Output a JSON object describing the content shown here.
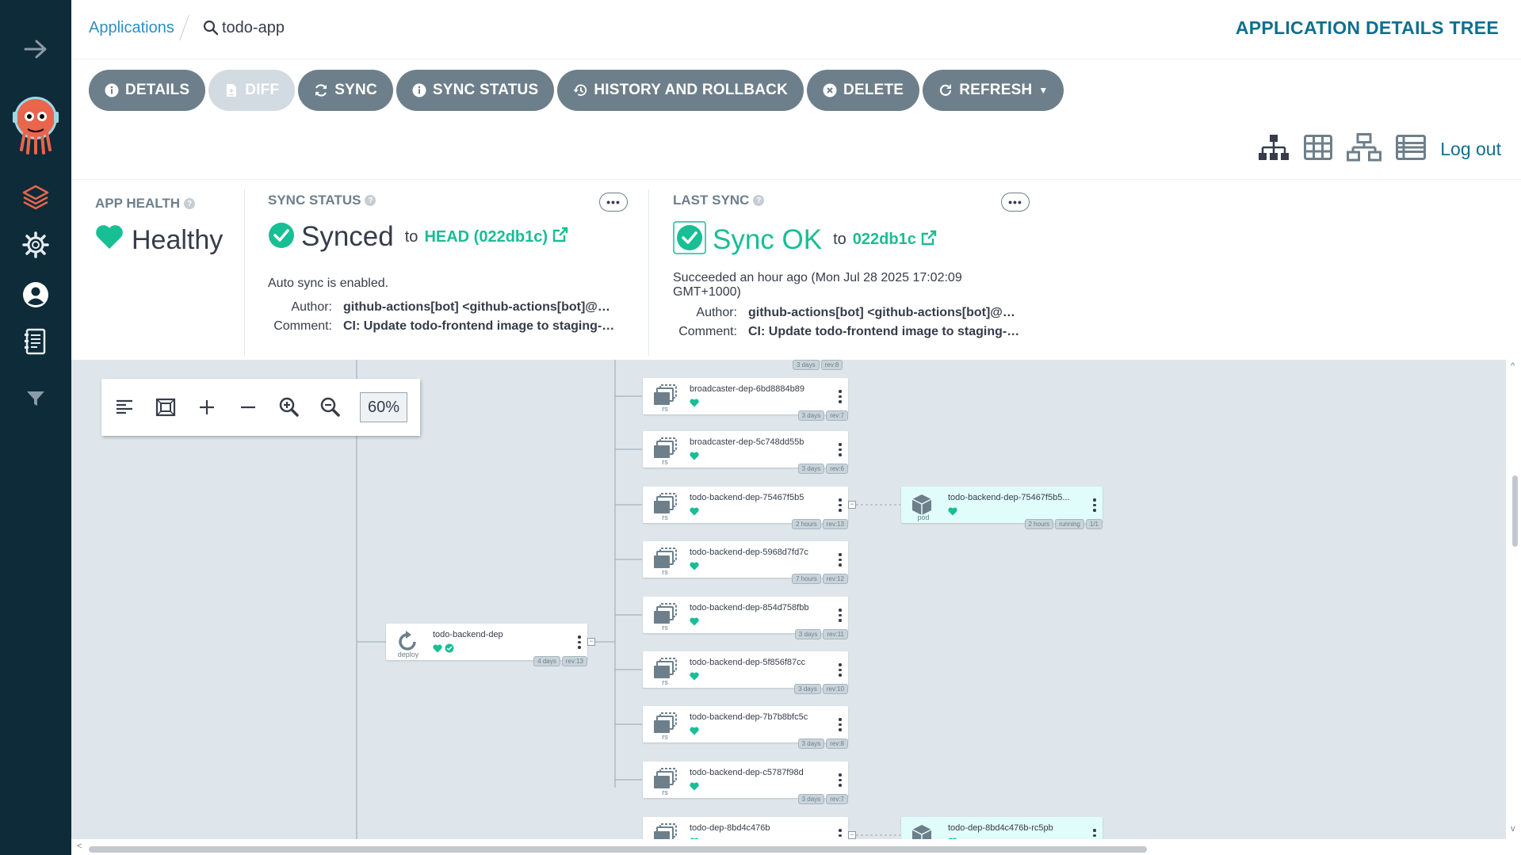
{
  "breadcrumb": {
    "link": "Applications",
    "current": "todo-app"
  },
  "page_title": "APPLICATION DETAILS TREE",
  "toolbar": {
    "details": "DETAILS",
    "diff": "DIFF",
    "sync": "SYNC",
    "sync_status": "SYNC STATUS",
    "history": "HISTORY AND ROLLBACK",
    "delete": "DELETE",
    "refresh": "REFRESH"
  },
  "logout": "Log out",
  "app_health": {
    "label": "APP HEALTH",
    "value": "Healthy"
  },
  "sync_status": {
    "label": "SYNC STATUS",
    "value": "Synced",
    "to": "to",
    "revision": "HEAD (022db1c)",
    "auto_sync": "Auto sync is enabled.",
    "author_label": "Author:",
    "author": "github-actions[bot] <github-actions[bot]@us...",
    "comment_label": "Comment:",
    "comment": "CI: Update todo-frontend image to staging-0..."
  },
  "last_sync": {
    "label": "LAST SYNC",
    "value": "Sync OK",
    "to": "to",
    "revision": "022db1c",
    "succeeded_line1": "Succeeded an hour ago (Mon Jul 28 2025 17:02:09",
    "succeeded_line2": "GMT+1000)",
    "author_label": "Author:",
    "author": "github-actions[bot] <github-actions[bot]@us...",
    "comment_label": "Comment:",
    "comment": "CI: Update todo-frontend image to staging-0..."
  },
  "zoom": {
    "value": "60%"
  },
  "graph": {
    "top_partial_tags": [
      "3 days",
      "rev:8"
    ],
    "deploy": {
      "name": "todo-backend-dep",
      "kind": "deploy",
      "tags": [
        "4 days",
        "rev:13"
      ]
    },
    "replicasets": [
      {
        "name": "broadcaster-dep-6bd8884b89",
        "kind": "rs",
        "tags": [
          "3 days",
          "rev:7"
        ]
      },
      {
        "name": "broadcaster-dep-5c748dd55b",
        "kind": "rs",
        "tags": [
          "3 days",
          "rev:6"
        ]
      },
      {
        "name": "todo-backend-dep-75467f5b5",
        "kind": "rs",
        "tags": [
          "2 hours",
          "rev:13"
        ]
      },
      {
        "name": "todo-backend-dep-5968d7fd7c",
        "kind": "rs",
        "tags": [
          "7 hours",
          "rev:12"
        ]
      },
      {
        "name": "todo-backend-dep-854d758fbb",
        "kind": "rs",
        "tags": [
          "3 days",
          "rev:11"
        ]
      },
      {
        "name": "todo-backend-dep-5f856f87cc",
        "kind": "rs",
        "tags": [
          "3 days",
          "rev:10"
        ]
      },
      {
        "name": "todo-backend-dep-7b7b8bfc5c",
        "kind": "rs",
        "tags": [
          "3 days",
          "rev:8"
        ]
      },
      {
        "name": "todo-backend-dep-c5787f98d",
        "kind": "rs",
        "tags": [
          "3 days",
          "rev:7"
        ]
      },
      {
        "name": "todo-dep-8bd4c476b",
        "kind": "rs",
        "tags": []
      }
    ],
    "pods": [
      {
        "name": "todo-backend-dep-75467f5b5...",
        "kind": "pod",
        "tags": [
          "2 hours",
          "running",
          "1/1"
        ]
      },
      {
        "name": "todo-dep-8bd4c476b-rc5pb",
        "kind": "pod",
        "tags": []
      }
    ]
  },
  "colors": {
    "sidebar": "#0d2b38",
    "button": "#6d7f8b",
    "healthy": "#18be94",
    "link": "#2b8fc3",
    "graph_bg": "#dee6eb"
  }
}
